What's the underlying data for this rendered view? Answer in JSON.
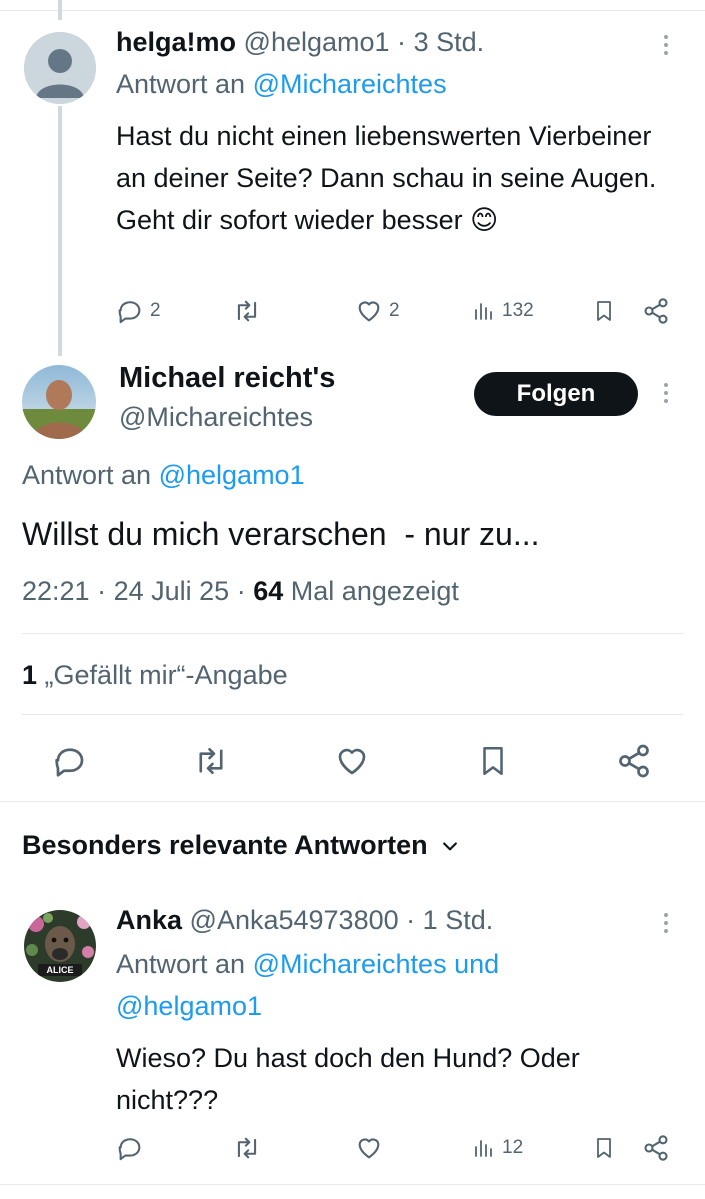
{
  "reply1": {
    "display_name": "helga!mo",
    "handle": "@helgamo1",
    "time": "3 Std.",
    "reply_prefix": "Antwort an",
    "reply_to": "@Michareichtes",
    "text": "Hast du nicht einen liebenswerten Vierbeiner an deiner Seite? Dann schau in seine Augen. Geht dir sofort wieder besser",
    "emoji": "😊",
    "replies": "2",
    "likes": "2",
    "views": "132"
  },
  "main": {
    "display_name": "Michael reicht's",
    "handle": "@Michareichtes",
    "follow_label": "Folgen",
    "reply_prefix": "Antwort an",
    "reply_to": "@helgamo1",
    "text": "Willst du mich verarschen  - nur zu...",
    "time": "22:21",
    "date": "24 Juli 25",
    "views_count": "64",
    "views_label": "Mal angezeigt",
    "likes_count": "1",
    "likes_label": "„Gefällt mir“-Angabe"
  },
  "section": {
    "title": "Besonders relevante Antworten"
  },
  "reply2": {
    "display_name": "Anka",
    "handle": "@Anka54973800",
    "time": "1 Std.",
    "reply_prefix": "Antwort an",
    "reply_to_1": "@Michareichtes",
    "reply_and": "und",
    "reply_to_2": "@helgamo1",
    "text_line1": "Wieso? Du hast doch den Hund? Oder",
    "text_line2": "nicht???",
    "avatar_badge": "ALICE",
    "views": "12"
  },
  "colors": {
    "accent": "#1d9bf0",
    "muted": "#536471",
    "follow_bg": "#0f1419"
  }
}
